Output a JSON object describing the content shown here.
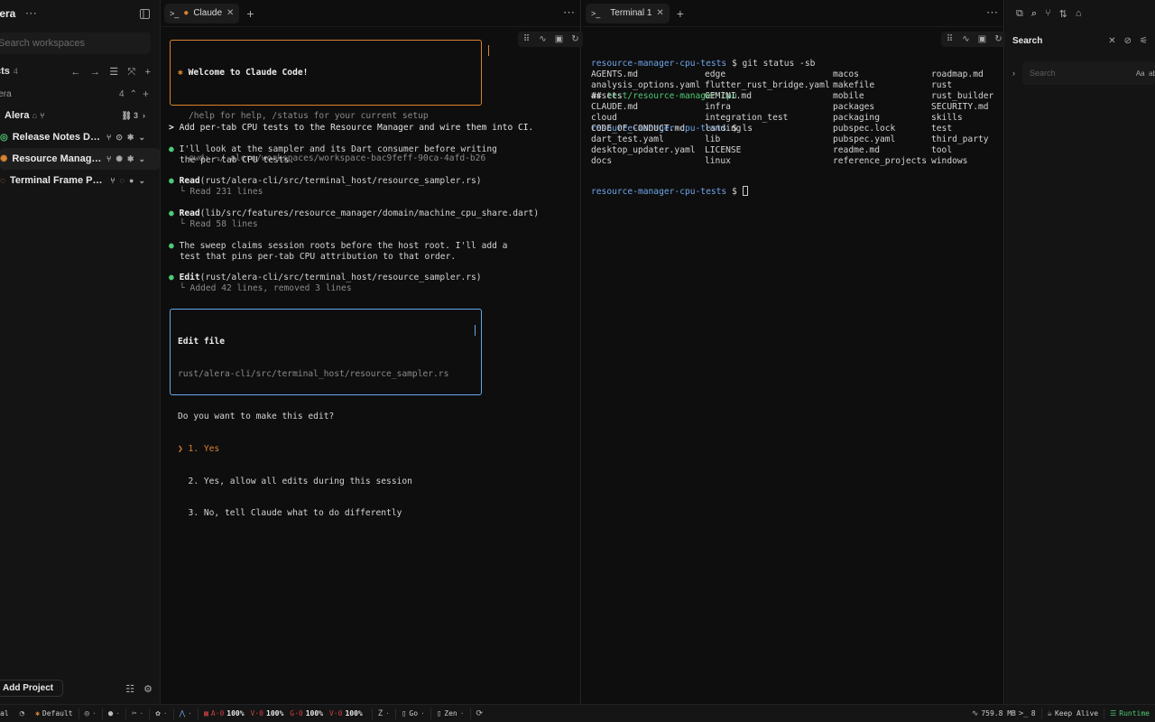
{
  "sidebar": {
    "title": "lera",
    "search_placeholder": "Search workspaces",
    "projects_label": "cts",
    "projects_count": "4",
    "group": {
      "label": "lera",
      "count": "4"
    },
    "root": {
      "label": "Alera",
      "badge": "3"
    },
    "items": [
      {
        "label": "Release Notes Draft",
        "status_color": "#4ec975",
        "badge_color": "#d98430"
      },
      {
        "label": "Resource Manager...",
        "status_color": "#d98430",
        "badge_color": "#d98430"
      },
      {
        "label": "Terminal Frame Pa...",
        "status_color": "#d98430",
        "badge_color": "#777777"
      }
    ],
    "add_project": "Add Project"
  },
  "paneA": {
    "tab_label": "Claude",
    "welcome": {
      "title": "Welcome to Claude Code!",
      "help": "/help for help, /status for your current setup",
      "cwd": "cwd: ~/.alera/workspaces/workspace-bac9feff-90ca-4afd-b26"
    },
    "prompt": "Add per-tab CPU tests to the Resource Manager and wire them into CI.",
    "msg1a": "I'll look at the sampler and its Dart consumer before writing",
    "msg1b": "the per-tab CPU tests.",
    "read1_tool": "Read",
    "read1_path": "(rust/alera-cli/src/terminal_host/resource_sampler.rs)",
    "read1_result": "└ Read 231 lines",
    "read2_tool": "Read",
    "read2_path": "(lib/src/features/resource_manager/domain/machine_cpu_share.dart)",
    "read2_result": "└ Read 58 lines",
    "msg2a": "The sweep claims session roots before the host root. I'll add a",
    "msg2b": "test that pins per-tab CPU attribution to that order.",
    "edit_tool": "Edit",
    "edit_path": "(rust/alera-cli/src/terminal_host/resource_sampler.rs)",
    "edit_result": "└ Added 42 lines, removed 3 lines",
    "edit_box": {
      "title": "Edit file",
      "path": "rust/alera-cli/src/terminal_host/resource_sampler.rs",
      "question": "Do you want to make this edit?",
      "opt1": "❯ 1. Yes",
      "opt2": "  2. Yes, allow all edits during this session",
      "opt3": "  3. No, tell Claude what to do differently"
    }
  },
  "paneB": {
    "tab_label": "Terminal 1",
    "prompt_name": "resource-manager-cpu-tests",
    "cmd1": "git status -sb",
    "branch_prefix": "## ",
    "branch": "test/resource-manager-cpu",
    "cmd2": "ls",
    "ls_cols": [
      [
        "AGENTS.md",
        "analysis_options.yaml",
        "assets",
        "CLAUDE.md",
        "cloud",
        "CODE_OF_CONDUCT.md",
        "dart_test.yaml",
        "desktop_updater.yaml",
        "docs"
      ],
      [
        "edge",
        "flutter_rust_bridge.yaml",
        "GEMINI.md",
        "infra",
        "integration_test",
        "landing",
        "lib",
        "LICENSE",
        "linux"
      ],
      [
        "macos",
        "makefile",
        "mobile",
        "packages",
        "packaging",
        "pubspec.lock",
        "pubspec.yaml",
        "readme.md",
        "reference_projects"
      ],
      [
        "roadmap.md",
        "rust",
        "rust_builder",
        "SECURITY.md",
        "skills",
        "test",
        "third_party",
        "tool",
        "windows"
      ]
    ]
  },
  "right": {
    "title": "Search",
    "placeholder": "Search",
    "opt_case": "Aa",
    "opt_word": "ab"
  },
  "status": {
    "left": "al",
    "profile": "Default",
    "cpu": [
      {
        "k": "A·0",
        "v": "100%"
      },
      {
        "k": "V·0",
        "v": "100%"
      },
      {
        "k": "G·0",
        "v": "100%"
      },
      {
        "k": "V·0",
        "v": "100%"
      }
    ],
    "go": "Go",
    "zen": "Zen",
    "memory": "759.8 MB",
    "shells": "8",
    "keep_alive": "Keep Alive",
    "runtime": "Runtime"
  },
  "colors": {
    "accent": "#d98430",
    "ok": "#4ec975",
    "link": "#6fa5ea"
  }
}
